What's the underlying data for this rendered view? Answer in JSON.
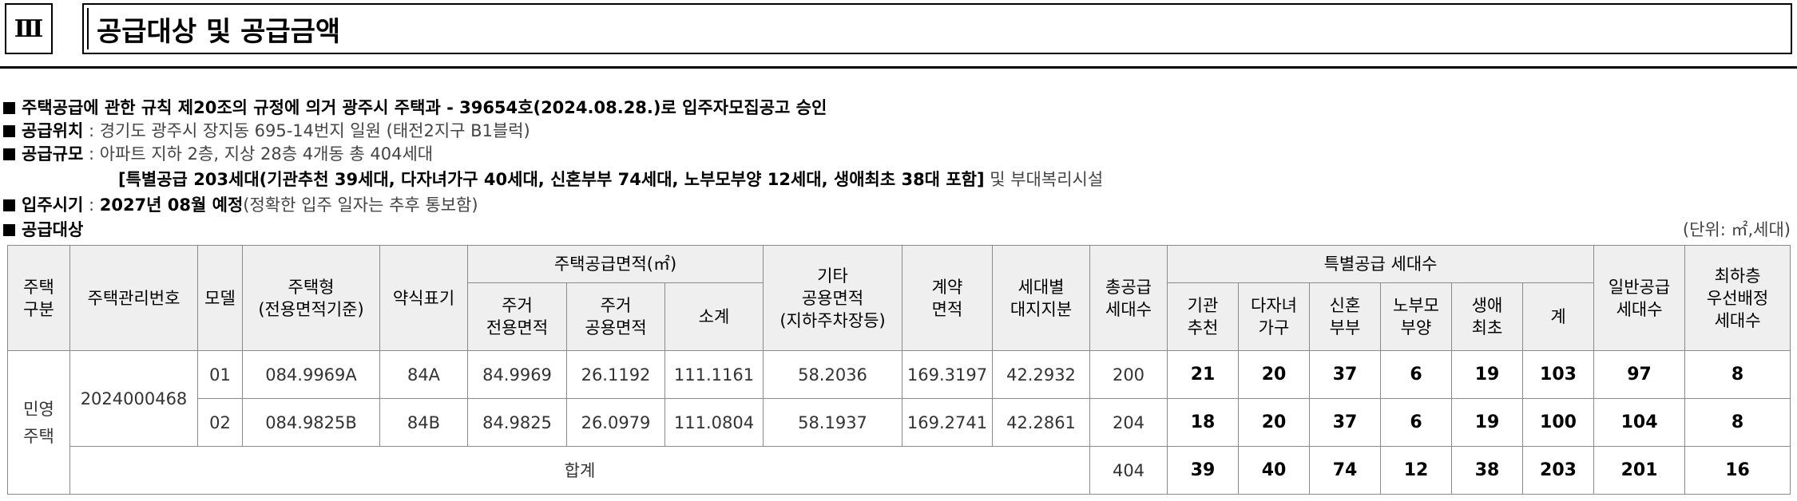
{
  "header": {
    "section_number": "Ⅲ",
    "title": "공급대상 및 공급금액"
  },
  "info": {
    "line1": "주택공급에 관한 규칙 제20조의 규정에 의거 광주시 주택과 - 39654호(2024.08.28.)로 입주자모집공고 승인",
    "location_label": "공급위치",
    "location_value": " : 경기도 광주시 장지동 695-14번지 일원 (태전2지구 B1블럭)",
    "scale_label": "공급규모",
    "scale_value": " : 아파트 지하 2층, 지상 28층 4개동 총 404세대",
    "scale_detail_bold": "[특별공급 203세대(기관추천 39세대, 다자녀가구 40세대, 신혼부부 74세대, 노부모부양 12세대, 생애최초 38대 포함]",
    "scale_detail_rest": " 및 부대복리시설",
    "movein_label": "입주시기",
    "movein_sep": " : ",
    "movein_bold": "2027년 08월 예정",
    "movein_note": "(정확한 입주 일자는 추후 통보함)",
    "target_label": "공급대상",
    "unit": "(단위: ㎡,세대)"
  },
  "table": {
    "headers": {
      "house_type_div": "주택\n구분",
      "mgmt_no": "주택관리번호",
      "model": "모델",
      "house_type": "주택형\n(전용면적기준)",
      "abbr": "약식표기",
      "supply_area": "주택공급면적(㎡)",
      "exclusive": "주거\n전용면적",
      "common": "주거\n공용면적",
      "subtotal": "소계",
      "other_common": "기타\n공용면적\n(지하주차장등)",
      "contract": "계약\n면적",
      "land_share": "세대별\n대지지분",
      "total_supply": "총공급\n세대수",
      "special": "특별공급 세대수",
      "inst": "기관\n추천",
      "multi": "다자녀\n가구",
      "newlywed": "신혼\n부부",
      "parents": "노부모\n부양",
      "first": "생애\n최초",
      "special_sum": "계",
      "general": "일반공급\n세대수",
      "lowest_floor": "최하층\n우선배정\n세대수"
    },
    "house_div": "민영\n주택",
    "mgmt_no": "2024000468",
    "rows": [
      {
        "model": "01",
        "type": "084.9969A",
        "abbr": "84A",
        "exclusive": "84.9969",
        "common": "26.1192",
        "subtotal": "111.1161",
        "other": "58.2036",
        "contract": "169.3197",
        "land": "42.2932",
        "total": "200",
        "inst": "21",
        "multi": "20",
        "newlywed": "37",
        "parents": "6",
        "first": "19",
        "sum": "103",
        "general": "97",
        "lowest": "8"
      },
      {
        "model": "02",
        "type": "084.9825B",
        "abbr": "84B",
        "exclusive": "84.9825",
        "common": "26.0979",
        "subtotal": "111.0804",
        "other": "58.1937",
        "contract": "169.2741",
        "land": "42.2861",
        "total": "204",
        "inst": "18",
        "multi": "20",
        "newlywed": "37",
        "parents": "6",
        "first": "19",
        "sum": "100",
        "general": "104",
        "lowest": "8"
      }
    ],
    "total_row": {
      "label": "합계",
      "total": "404",
      "inst": "39",
      "multi": "40",
      "newlywed": "74",
      "parents": "12",
      "first": "38",
      "sum": "203",
      "general": "201",
      "lowest": "16"
    }
  }
}
